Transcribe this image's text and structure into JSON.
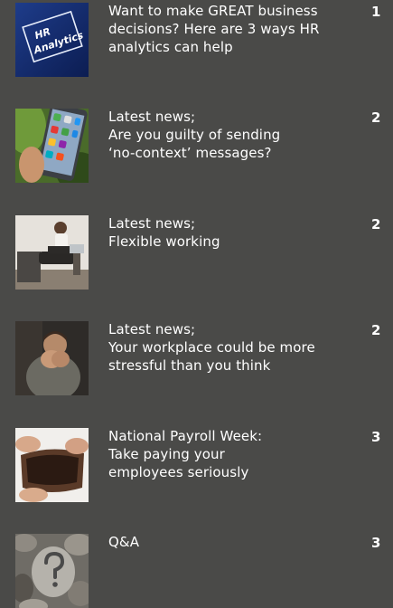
{
  "toc": {
    "items": [
      {
        "title_lines": [
          "Want to make GREAT business",
          "decisions? Here are 3 ways HR",
          "analytics can help"
        ],
        "page": "1",
        "icon": "hr-analytics-thumbnail"
      },
      {
        "title_lines": [
          "Latest news;",
          "Are you guilty of sending",
          "‘no-context’ messages?"
        ],
        "page": "2",
        "icon": "smartphone-apps-thumbnail"
      },
      {
        "title_lines": [
          "Latest news;",
          "Flexible working"
        ],
        "page": "2",
        "icon": "woman-laptop-thumbnail"
      },
      {
        "title_lines": [
          "Latest news;",
          "Your workplace could be more",
          "stressful than you think"
        ],
        "page": "2",
        "icon": "stressed-man-thumbnail"
      },
      {
        "title_lines": [
          "National Payroll Week:",
          "Take paying your",
          "employees seriously"
        ],
        "page": "3",
        "icon": "empty-wallet-thumbnail"
      },
      {
        "title_lines": [
          "Q&A"
        ],
        "page": "3",
        "icon": "question-stone-thumbnail"
      }
    ]
  },
  "thumbs": {
    "hr_text_line1": "HR",
    "hr_text_line2": "Analytics"
  }
}
